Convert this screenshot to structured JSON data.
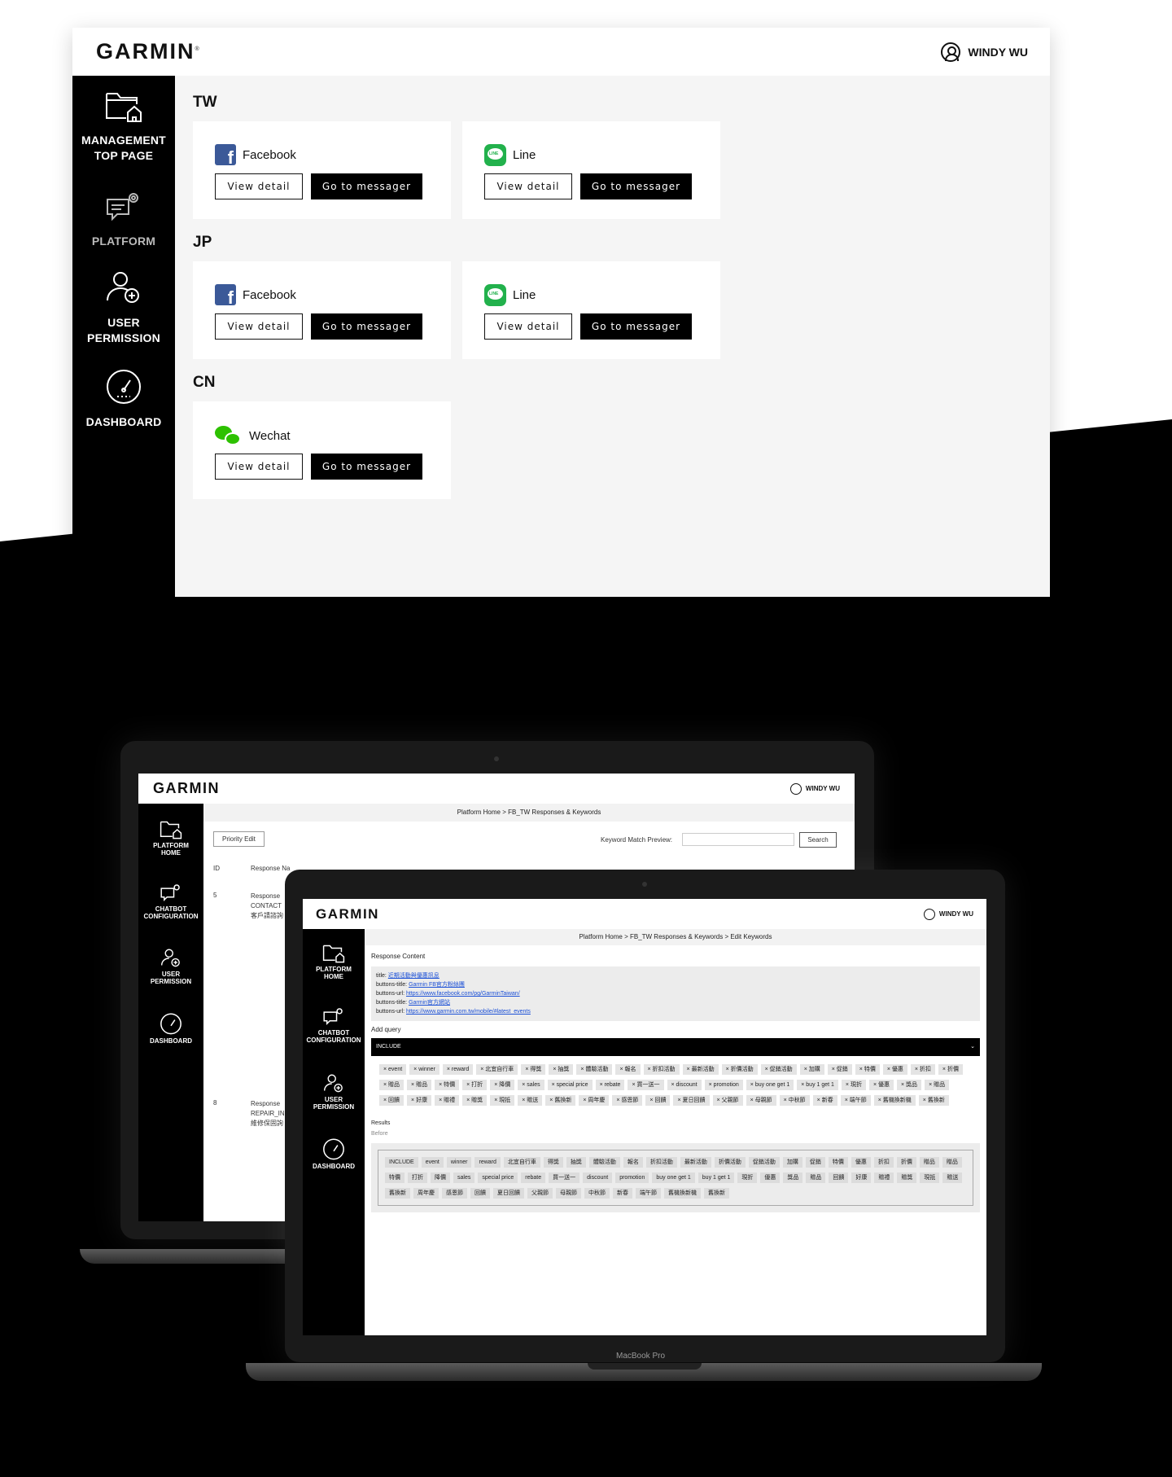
{
  "app": {
    "logo": "GARMIN",
    "user_name": "WINDY WU",
    "sidebar": [
      {
        "label": "MANAGEMENT\nTOP PAGE",
        "icon": "folder-home-icon"
      },
      {
        "label": "PLATFORM",
        "icon": "chat-gear-icon"
      },
      {
        "label": "USER\nPERMISSION",
        "icon": "user-add-icon"
      },
      {
        "label": "DASHBOARD",
        "icon": "gauge-icon"
      }
    ],
    "regions": [
      {
        "name": "TW",
        "cards": [
          {
            "platform": "Facebook",
            "view": "View detail",
            "go": "Go to messager"
          },
          {
            "platform": "Line",
            "view": "View detail",
            "go": "Go to messager"
          }
        ]
      },
      {
        "name": "JP",
        "cards": [
          {
            "platform": "Facebook",
            "view": "View detail",
            "go": "Go to messager"
          },
          {
            "platform": "Line",
            "view": "View detail",
            "go": "Go to messager"
          }
        ]
      },
      {
        "name": "CN",
        "cards": [
          {
            "platform": "Wechat",
            "view": "View detail",
            "go": "Go to messager"
          }
        ]
      }
    ]
  },
  "back_laptop": {
    "logo": "GARMIN",
    "user_name": "WINDY WU",
    "nav": [
      "PLATFORM\nHOME",
      "CHATBOT\nCONFIGURATION",
      "USER\nPERMISSION",
      "DASHBOARD"
    ],
    "breadcrumb": "Platform Home  >  FB_TW Responses & Keywords",
    "tab": "Priority Edit",
    "keyword_label": "Keyword Match Preview:",
    "search_button": "Search",
    "col_id": "ID",
    "col_response": "Response Na",
    "rows": [
      {
        "id": "5",
        "text": "Response\nCONTACT\n客戶請諮詢"
      },
      {
        "id": "8",
        "text": "Response\nREPAIR_IN\n維修保固詢"
      }
    ]
  },
  "front_laptop": {
    "logo": "GARMIN",
    "user_name": "WINDY WU",
    "nav": [
      "PLATFORM\nHOME",
      "CHATBOT\nCONFIGURATION",
      "USER\nPERMISSION",
      "DASHBOARD"
    ],
    "breadcrumb": "Platform Home  >  FB_TW Responses & Keywords  >  Edit Keywords",
    "response_content_label": "Response Content",
    "response_lines": [
      {
        "key": "title:",
        "value": "近期活動與優惠訊息"
      },
      {
        "key": "buttons-title:",
        "value": "Garmin FB官方粉絲團"
      },
      {
        "key": "buttons-url:",
        "value": "https://www.facebook.com/pg/GarminTaiwan/"
      },
      {
        "key": "buttons-title:",
        "value": "Garmin官方網站"
      },
      {
        "key": "buttons-url:",
        "value": "https://www.garmin.com.tw/mobile/#latest_events"
      }
    ],
    "add_query_label": "Add query",
    "include_label": "INCLUDE",
    "keywords": [
      "event",
      "winner",
      "reward",
      "北宜自行車",
      "得獎",
      "抽獎",
      "體驗活動",
      "報名",
      "折扣活動",
      "最新活動",
      "折價活動",
      "促銷活動",
      "加購",
      "促銷",
      "特價",
      "優惠",
      "折扣",
      "折價",
      "贈品",
      "贈品",
      "特價",
      "打折",
      "降價",
      "sales",
      "special price",
      "rebate",
      "買一送一",
      "discount",
      "promotion",
      "buy one get 1",
      "buy 1 get 1",
      "現折",
      "優惠",
      "獎品",
      "贈品",
      "回饋",
      "好康",
      "贈禮",
      "贈獎",
      "現抵",
      "贈送",
      "舊換新",
      "周年慶",
      "感恩節",
      "回饋",
      "夏日回饋",
      "父親節",
      "母親節",
      "中秋節",
      "新春",
      "端午節",
      "舊機換新機",
      "舊換新"
    ],
    "results_label": "Results",
    "before_label": "Before",
    "results": [
      "INCLUDE",
      "event",
      "winner",
      "reward",
      "北宜自行車",
      "得獎",
      "抽獎",
      "體驗活動",
      "報名",
      "折扣活動",
      "最新活動",
      "折價活動",
      "促銷活動",
      "加購",
      "促銷",
      "特價",
      "優惠",
      "折扣",
      "折價",
      "贈品",
      "贈品",
      "特價",
      "打折",
      "降價",
      "sales",
      "special price",
      "rebate",
      "買一送一",
      "discount",
      "promotion",
      "buy one get 1",
      "buy 1 get 1",
      "現折",
      "優惠",
      "獎品",
      "贈品",
      "回饋",
      "好康",
      "贈禮",
      "贈獎",
      "現抵",
      "贈送",
      "舊換新",
      "周年慶",
      "感恩節",
      "回饋",
      "夏日回饋",
      "父親節",
      "母親節",
      "中秋節",
      "新春",
      "端午節",
      "舊機換新機",
      "舊換新"
    ],
    "macbook_label": "MacBook Pro"
  }
}
